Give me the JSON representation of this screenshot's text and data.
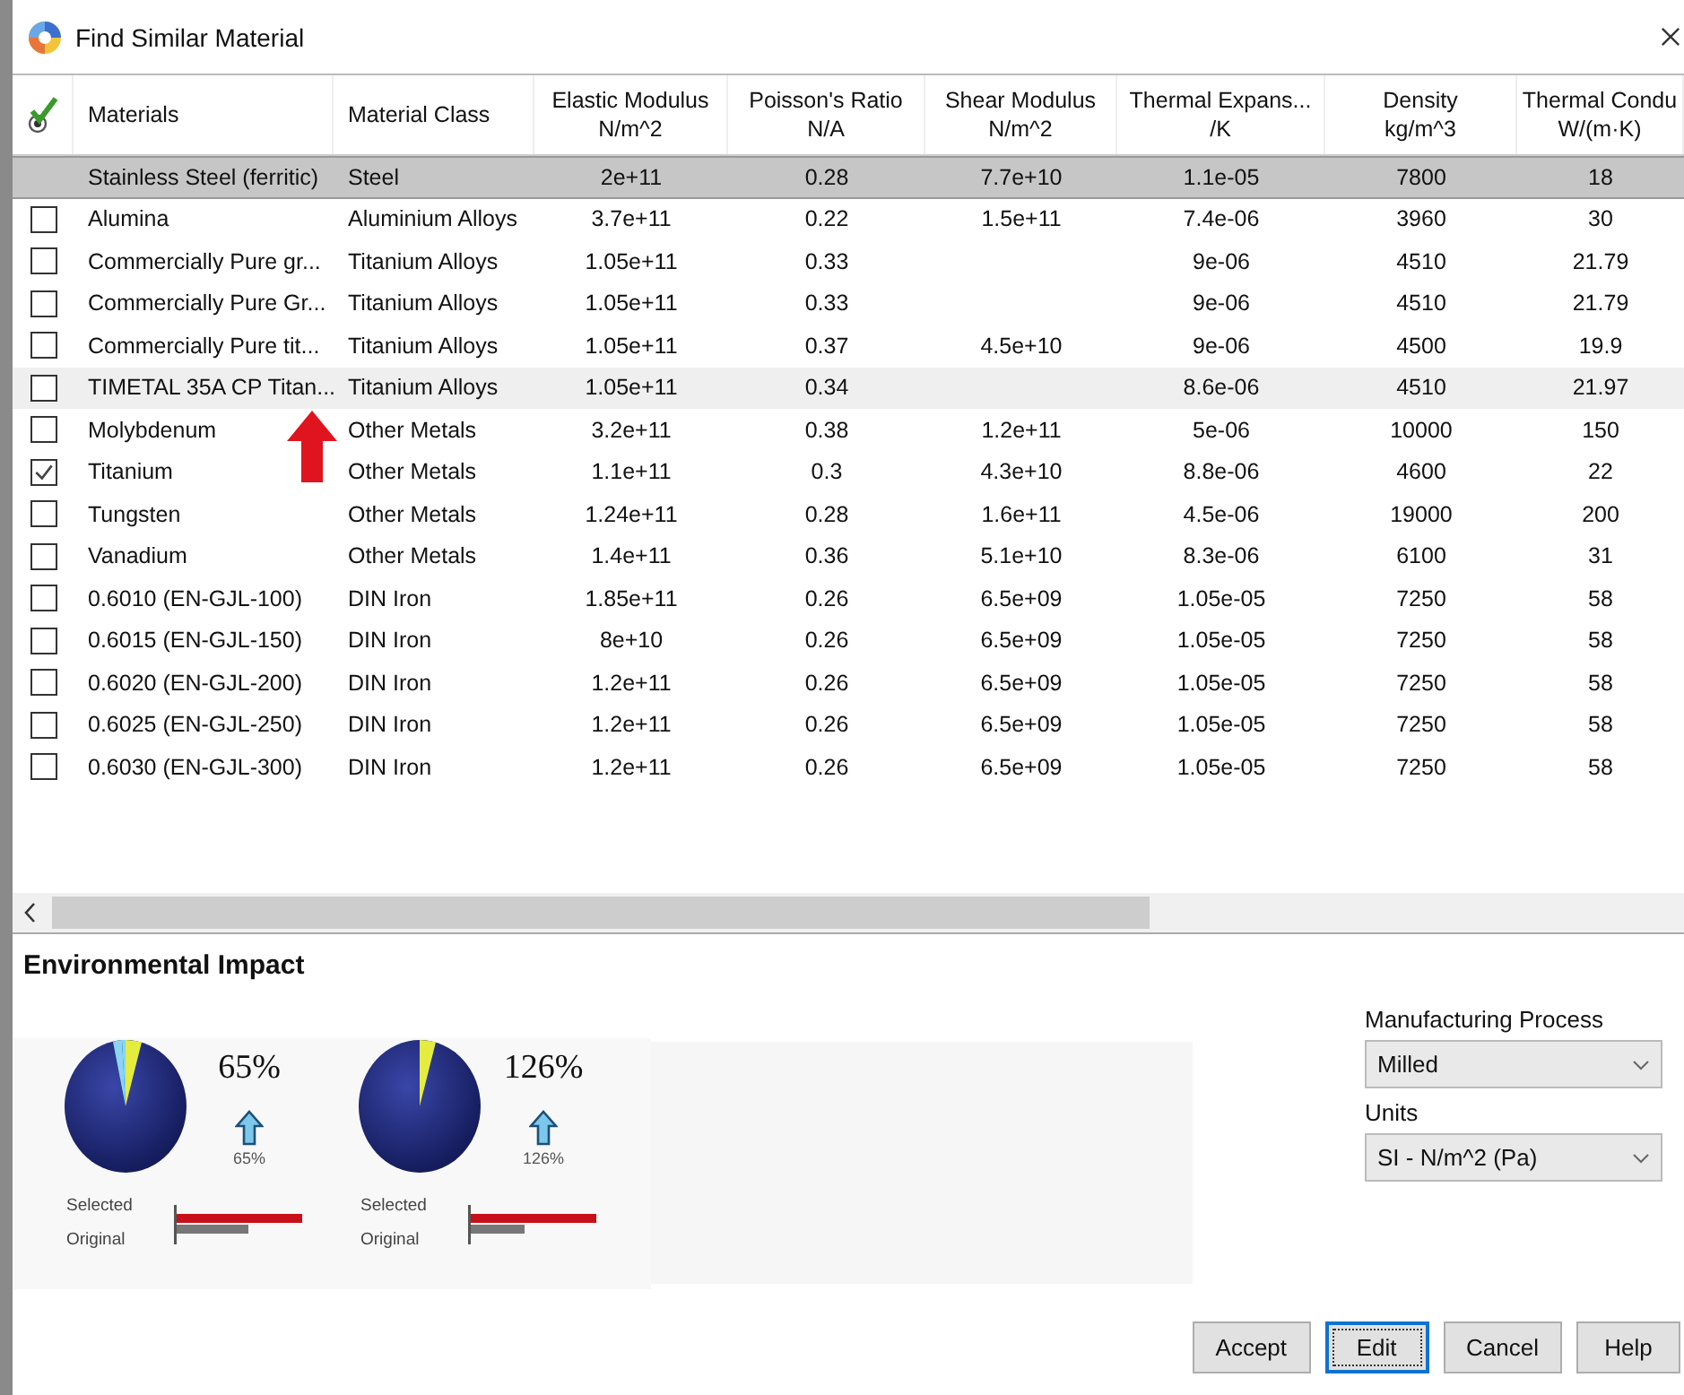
{
  "window": {
    "title": "Find Similar Material"
  },
  "table": {
    "columns": [
      {
        "title": "Materials"
      },
      {
        "title": "Material Class"
      },
      {
        "title": "Elastic Modulus",
        "unit": "N/m^2"
      },
      {
        "title": "Poisson's Ratio",
        "unit": "N/A"
      },
      {
        "title": "Shear Modulus",
        "unit": "N/m^2"
      },
      {
        "title": "Thermal Expans...",
        "unit": "/K"
      },
      {
        "title": "Density",
        "unit": "kg/m^3"
      },
      {
        "title": "Thermal Condu",
        "unit": "W/(m·K)"
      }
    ],
    "rows": [
      {
        "kind": "reference",
        "selected": false,
        "cells": [
          "Stainless Steel (ferritic)",
          "Steel",
          "2e+11",
          "0.28",
          "7.7e+10",
          "1.1e-05",
          "7800",
          "18"
        ]
      },
      {
        "kind": "candidate",
        "checked": false,
        "selected": false,
        "cells": [
          "Alumina",
          "Aluminium Alloys",
          "3.7e+11",
          "0.22",
          "1.5e+11",
          "7.4e-06",
          "3960",
          "30"
        ]
      },
      {
        "kind": "candidate",
        "checked": false,
        "selected": false,
        "cells": [
          "Commercially Pure gr...",
          "Titanium Alloys",
          "1.05e+11",
          "0.33",
          null,
          "9e-06",
          "4510",
          "21.79"
        ]
      },
      {
        "kind": "candidate",
        "checked": false,
        "selected": false,
        "cells": [
          "Commercially Pure Gr...",
          "Titanium Alloys",
          "1.05e+11",
          "0.33",
          null,
          "9e-06",
          "4510",
          "21.79"
        ]
      },
      {
        "kind": "candidate",
        "checked": false,
        "selected": false,
        "cells": [
          "Commercially Pure tit...",
          "Titanium Alloys",
          "1.05e+11",
          "0.37",
          "4.5e+10",
          "9e-06",
          "4500",
          "19.9"
        ]
      },
      {
        "kind": "candidate",
        "checked": false,
        "selected": true,
        "cells": [
          "TIMETAL 35A CP Titan...",
          "Titanium Alloys",
          "1.05e+11",
          "0.34",
          null,
          "8.6e-06",
          "4510",
          "21.97"
        ]
      },
      {
        "kind": "candidate",
        "checked": false,
        "selected": false,
        "cells": [
          "Molybdenum",
          "Other Metals",
          "3.2e+11",
          "0.38",
          "1.2e+11",
          "5e-06",
          "10000",
          "150"
        ]
      },
      {
        "kind": "candidate",
        "checked": true,
        "selected": false,
        "cells": [
          "Titanium",
          "Other Metals",
          "1.1e+11",
          "0.3",
          "4.3e+10",
          "8.8e-06",
          "4600",
          "22"
        ]
      },
      {
        "kind": "candidate",
        "checked": false,
        "selected": false,
        "cells": [
          "Tungsten",
          "Other Metals",
          "1.24e+11",
          "0.28",
          "1.6e+11",
          "4.5e-06",
          "19000",
          "200"
        ]
      },
      {
        "kind": "candidate",
        "checked": false,
        "selected": false,
        "cells": [
          "Vanadium",
          "Other Metals",
          "1.4e+11",
          "0.36",
          "5.1e+10",
          "8.3e-06",
          "6100",
          "31"
        ]
      },
      {
        "kind": "candidate",
        "checked": false,
        "selected": false,
        "cells": [
          "0.6010 (EN-GJL-100)",
          "DIN Iron",
          "1.85e+11",
          "0.26",
          "6.5e+09",
          "1.05e-05",
          "7250",
          "58"
        ]
      },
      {
        "kind": "candidate",
        "checked": false,
        "selected": false,
        "cells": [
          "0.6015 (EN-GJL-150)",
          "DIN Iron",
          "8e+10",
          "0.26",
          "6.5e+09",
          "1.05e-05",
          "7250",
          "58"
        ]
      },
      {
        "kind": "candidate",
        "checked": false,
        "selected": false,
        "cells": [
          "0.6020 (EN-GJL-200)",
          "DIN Iron",
          "1.2e+11",
          "0.26",
          "6.5e+09",
          "1.05e-05",
          "7250",
          "58"
        ]
      },
      {
        "kind": "candidate",
        "checked": false,
        "selected": false,
        "cells": [
          "0.6025 (EN-GJL-250)",
          "DIN Iron",
          "1.2e+11",
          "0.26",
          "6.5e+09",
          "1.05e-05",
          "7250",
          "58"
        ]
      },
      {
        "kind": "candidate",
        "checked": false,
        "selected": false,
        "cells": [
          "0.6030 (EN-GJL-300)",
          "DIN Iron",
          "1.2e+11",
          "0.26",
          "6.5e+09",
          "1.05e-05",
          "7250",
          "58"
        ]
      }
    ]
  },
  "environmental_impact": {
    "title": "Environmental Impact",
    "gauges": [
      {
        "percent": "65%",
        "change": "65%",
        "selected_label": "Selected",
        "original_label": "Original"
      },
      {
        "percent": "126%",
        "change": "126%",
        "selected_label": "Selected",
        "original_label": "Original"
      }
    ]
  },
  "options": {
    "fields": [
      {
        "label": "Manufacturing Process",
        "value": "Milled"
      },
      {
        "label": "Units",
        "value": "SI - N/m^2 (Pa)"
      }
    ]
  },
  "buttons": [
    {
      "label": "Accept",
      "focused": false
    },
    {
      "label": "Edit",
      "focused": true
    },
    {
      "label": "Cancel",
      "focused": false
    },
    {
      "label": "Help",
      "focused": false
    }
  ]
}
